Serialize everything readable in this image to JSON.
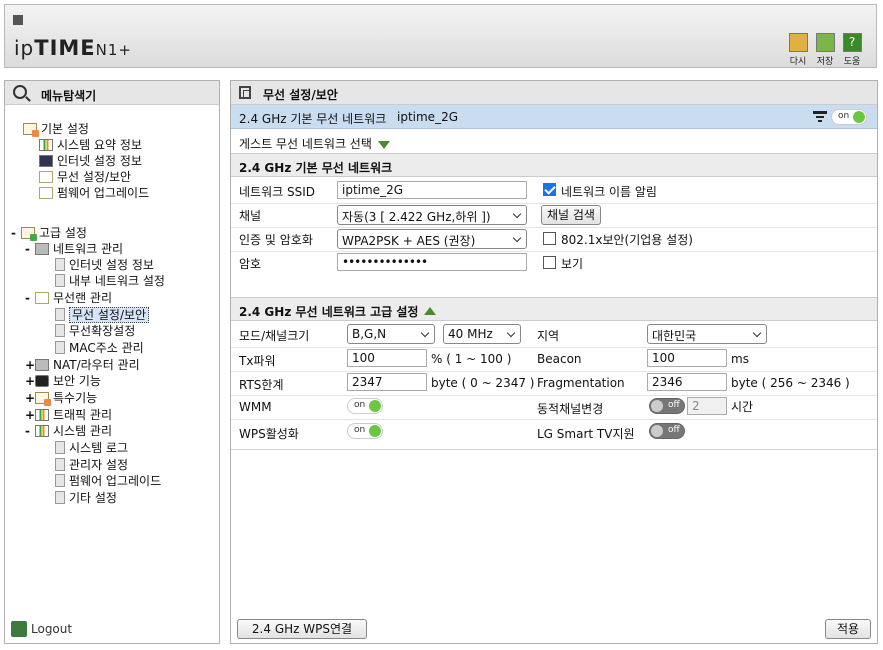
{
  "header": {
    "logo_prefix": "ip",
    "logo_bold": "TIME",
    "logo_model": "N1+",
    "buttons": [
      {
        "label": "다시",
        "icon": "undo-icon",
        "color": "#d9a020"
      },
      {
        "label": "저장",
        "icon": "save-icon",
        "color": "#5aa02c"
      },
      {
        "label": "도움",
        "icon": "help-icon",
        "color": "#3a8a2a"
      }
    ]
  },
  "sidebar": {
    "title": "메뉴탐색기",
    "basic": {
      "label": "기본 설정",
      "items": [
        "시스템 요약 정보",
        "인터넷 설정 정보",
        "무선 설정/보안",
        "펌웨어 업그레이드"
      ]
    },
    "advanced": {
      "label": "고급 설정",
      "network": {
        "label": "네트워크 관리",
        "items": [
          "인터넷 설정 정보",
          "내부 네트워크 설정"
        ]
      },
      "wireless": {
        "label": "무선랜 관리",
        "items": [
          "무선 설정/보안",
          "무선확장설정",
          "MAC주소 관리"
        ]
      },
      "nat": "NAT/라우터 관리",
      "security": "보안 기능",
      "special": "특수기능",
      "traffic": "트래픽 관리",
      "system": {
        "label": "시스템 관리",
        "items": [
          "시스템 로그",
          "관리자 설정",
          "펌웨어 업그레이드",
          "기타 설정"
        ]
      }
    },
    "logout": "Logout"
  },
  "main": {
    "title": "무선 설정/보안",
    "band_bar": {
      "label": "2.4 GHz 기본 무선 네트워크",
      "ssid": "iptime_2G",
      "toggle": "on"
    },
    "guest_label": "게스트 무선 네트워크 선택",
    "basic_section": {
      "title": "2.4 GHz 기본 무선 네트워크",
      "ssid_label": "네트워크 SSID",
      "ssid_value": "iptime_2G",
      "broadcast_label": "네트워크 이름 알림",
      "channel_label": "채널",
      "channel_value": "자동(3 [ 2.422 GHz,하위 ])",
      "channel_search": "채널 검색",
      "auth_label": "인증 및 암호화",
      "auth_value": "WPA2PSK + AES (권장)",
      "enterprise_label": "802.1x보안(기업용 설정)",
      "password_label": "암호",
      "password_value": "••••••••••••••",
      "show_label": "보기"
    },
    "advanced_section": {
      "title": "2.4 GHz 무선 네트워크 고급 설정",
      "mode_label": "모드/채널크기",
      "mode_value": "B,G,N",
      "width_value": "40 MHz",
      "region_label": "지역",
      "region_value": "대한민국",
      "tx_label": "Tx파워",
      "tx_value": "100",
      "tx_range": "% ( 1 ~ 100 )",
      "beacon_label": "Beacon",
      "beacon_value": "100",
      "beacon_unit": "ms",
      "rts_label": "RTS한계",
      "rts_value": "2347",
      "rts_range": "byte ( 0 ~ 2347 )",
      "frag_label": "Fragmentation",
      "frag_value": "2346",
      "frag_range": "byte ( 256 ~ 2346 )",
      "wmm_label": "WMM",
      "wmm_toggle": "on",
      "dyn_label": "동적채널변경",
      "dyn_toggle": "off",
      "dyn_value": "2",
      "dyn_unit": "시간",
      "wps_label": "WPS활성화",
      "wps_toggle": "on",
      "lg_label": "LG Smart TV지원",
      "lg_toggle": "off"
    },
    "wps_button": "2.4 GHz WPS연결",
    "apply_button": "적용"
  }
}
